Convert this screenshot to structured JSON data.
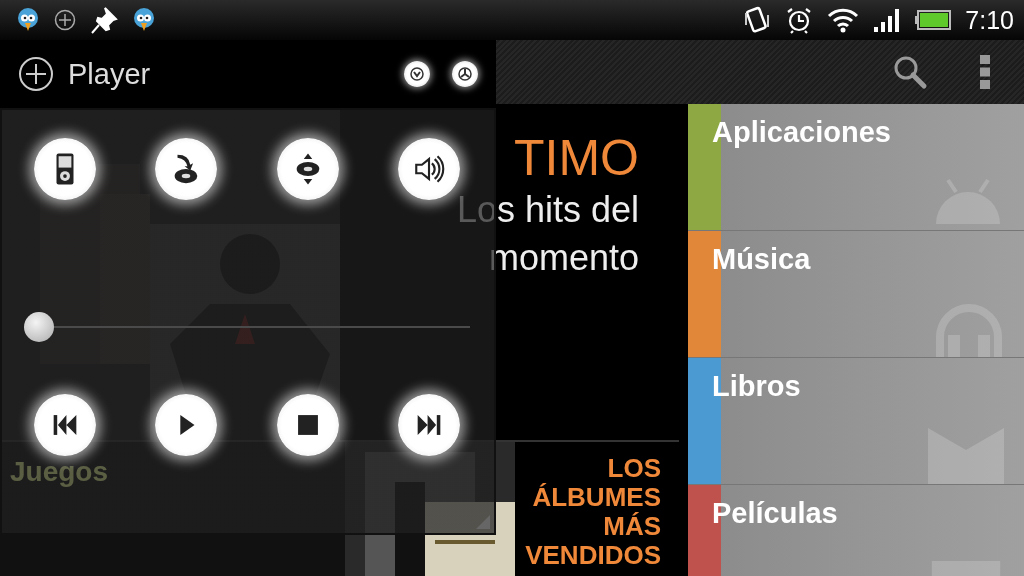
{
  "status_bar": {
    "time": "7:10"
  },
  "promo": {
    "headline": "TIMO",
    "subtitle_lines": [
      "Los hits del",
      "momento"
    ]
  },
  "tiles": [
    {
      "label": "Juegos"
    }
  ],
  "albums_promo": {
    "lines": [
      "LOS",
      "ÁLBUMES",
      "MÁS",
      "VENDIDOS"
    ]
  },
  "categories": [
    {
      "label": "Aplicaciones",
      "color": "#8ea843",
      "kind": "apps"
    },
    {
      "label": "Música",
      "color": "#e0873a",
      "kind": "music"
    },
    {
      "label": "Libros",
      "color": "#4b9ad2",
      "kind": "books"
    },
    {
      "label": "Películas",
      "color": "#c0524e",
      "kind": "movies"
    }
  ],
  "player": {
    "title": "Player",
    "position": {
      "level": 0
    }
  }
}
